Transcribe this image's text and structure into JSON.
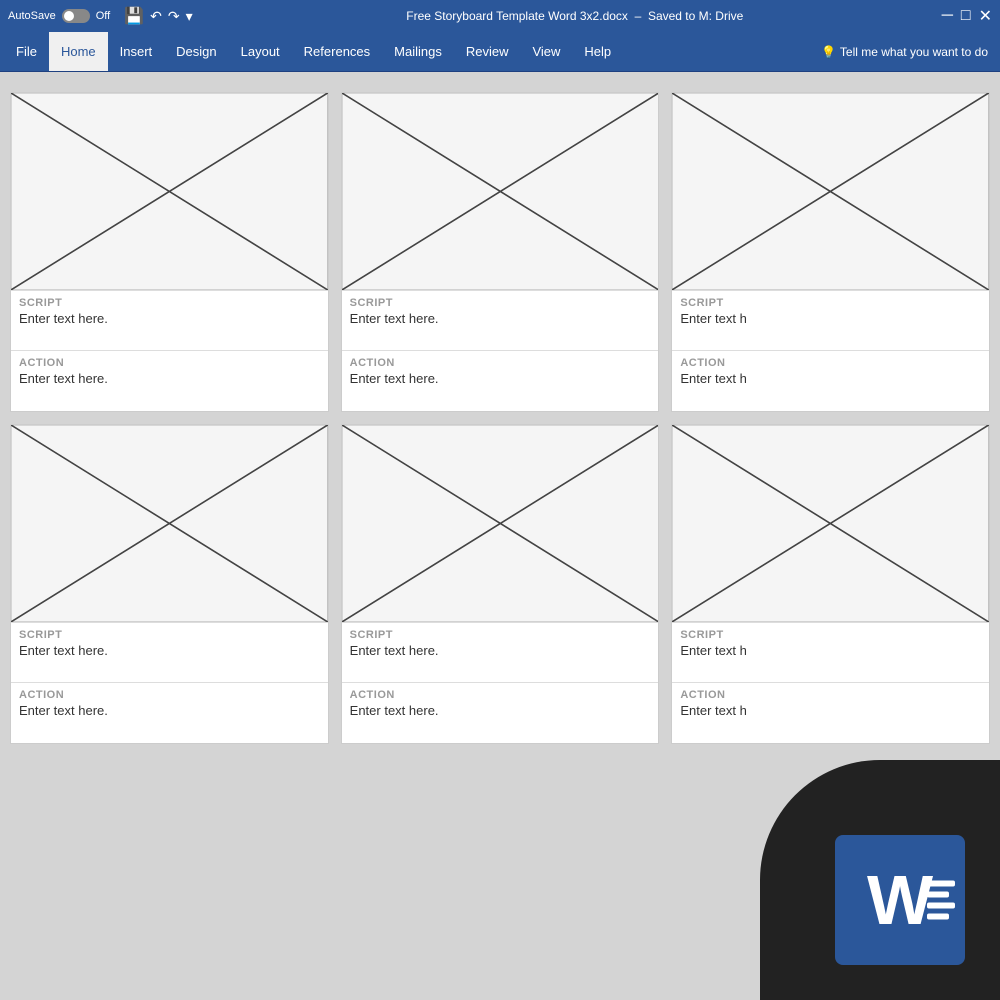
{
  "titleBar": {
    "autosave": "AutoSave",
    "toggleState": "Off",
    "title": "Free Storyboard Template Word 3x2.docx",
    "savedTo": "Saved to M: Drive"
  },
  "ribbon": {
    "tabs": [
      "File",
      "Home",
      "Insert",
      "Design",
      "Layout",
      "References",
      "Mailings",
      "Review",
      "View",
      "Help"
    ],
    "activeTab": "Home",
    "searchPlaceholder": "Tell me what you want to do"
  },
  "storyboard": {
    "rows": [
      {
        "cards": [
          {
            "scriptLabel": "SCRIPT",
            "scriptText": "Enter text here.",
            "actionLabel": "ACTION",
            "actionText": "Enter text here."
          },
          {
            "scriptLabel": "SCRIPT",
            "scriptText": "Enter text here.",
            "actionLabel": "ACTION",
            "actionText": "Enter text here."
          },
          {
            "scriptLabel": "SCRIPT",
            "scriptText": "Enter text h",
            "actionLabel": "ACTION",
            "actionText": "Enter text h"
          }
        ]
      },
      {
        "cards": [
          {
            "scriptLabel": "SCRIPT",
            "scriptText": "Enter text here.",
            "actionLabel": "ACTION",
            "actionText": "Enter text here."
          },
          {
            "scriptLabel": "SCRIPT",
            "scriptText": "Enter text here.",
            "actionLabel": "ACTION",
            "actionText": "Enter text here."
          },
          {
            "scriptLabel": "SCRIPT",
            "scriptText": "Enter text h",
            "actionLabel": "ACTION",
            "actionText": "Enter text h"
          }
        ]
      }
    ]
  },
  "wordLogo": {
    "letter": "W"
  }
}
